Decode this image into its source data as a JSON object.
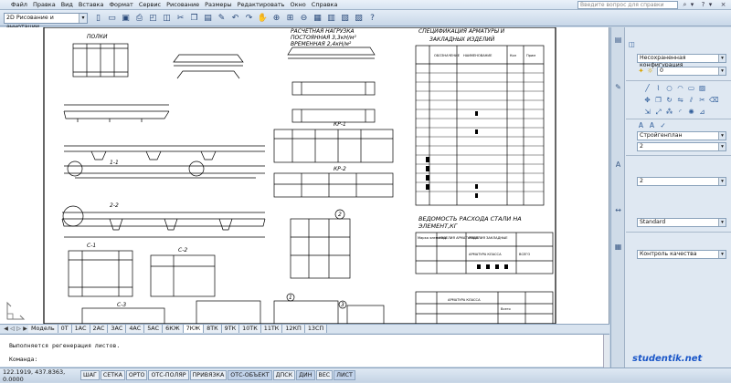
{
  "menu": {
    "items": [
      "Файл",
      "Правка",
      "Вид",
      "Вставка",
      "Формат",
      "Сервис",
      "Рисование",
      "Размеры",
      "Редактировать",
      "Окно",
      "Справка"
    ],
    "help_placeholder": "Введите вопрос для справки"
  },
  "toolbar": {
    "workspace": "2D Рисование и аннотации"
  },
  "drawing": {
    "labels": {
      "polki": "ПОЛКИ",
      "section_1": "1-1",
      "section_2": "2-2",
      "section_c1": "С-1",
      "section_c2": "С-2",
      "section_c3": "С-3",
      "kr1": "КР-1",
      "kr2": "КР-2",
      "marker_1": "1",
      "marker_2": "2",
      "marker_3": "3",
      "hdr_loads": "РАСЧЕТНАЯ НАГРУЗКА",
      "hdr_perm": "ПОСТОЯННАЯ 3,3кН/м²",
      "hdr_temp": "ВРЕМЕННАЯ 2,4кН/м²",
      "hdr_spec1": "СПЕЦИФИКАЦИЯ АРМАТУРЫ И",
      "hdr_spec2": "ЗАКЛАДНЫХ ИЗДЕЛИЙ",
      "col_desig": "ОБОЗНАЧЕНИЕ",
      "col_name": "НАИМЕНОВАНИЕ",
      "col_qty": "Кол",
      "col_note": "Прим",
      "ved1": "ВЕДОМОСТЬ РАСХОДА СТАЛИ НА",
      "ved2": "ЭЛЕМЕНТ,КГ",
      "vt_col1": "Марка элемента",
      "vt_col2": "ИЗДЕЛИЯ АРМАТУРНЫЕ",
      "vt_col3": "ИЗДЕЛИЯ ЗАКЛАДНЫЕ",
      "vt_armclass1": "АРМАТУРА КЛАССА",
      "vt_armclass2": "АРМАТУРА КЛАССА",
      "vt_total": "ВСЕГО",
      "vt_total2": "Всего"
    }
  },
  "tabs": {
    "items": [
      "Модель",
      "0Т",
      "1АС",
      "2АС",
      "3АС",
      "4АС",
      "5АС",
      "6КЖ",
      "7КЖ",
      "8ТК",
      "9ТК",
      "10ТК",
      "11ТК",
      "12КП",
      "13СП"
    ],
    "active": "7КЖ"
  },
  "command": {
    "history": "Выполняется регенерация листов.",
    "prompt": "Команда:"
  },
  "status": {
    "coords": "122.1919, 437.8363, 0.0000",
    "buttons": [
      "ШАГ",
      "СЕТКА",
      "ОРТО",
      "ОТС-ПОЛЯР",
      "ПРИВЯЗКА",
      "ОТС-ОБЪЕКТ",
      "ДПСК",
      "ДИН",
      "ВЕС",
      "ЛИСТ"
    ],
    "active_buttons": [
      "ОТС-ОБЪЕКТ",
      "ДИН",
      "ЛИСТ"
    ]
  },
  "panel": {
    "visual_style": "Несохраненная конфигурация",
    "layer": "0",
    "text_style": "Стройгенплан",
    "text_height": "2",
    "dim_scale": "2",
    "dim_style": "Standard",
    "layer_filter": "Контроль качества"
  },
  "watermark": "studentik.net",
  "colors": {
    "accent": "#1a56c8",
    "chrome": "#d6e3f1",
    "canvas": "#ffffff"
  }
}
